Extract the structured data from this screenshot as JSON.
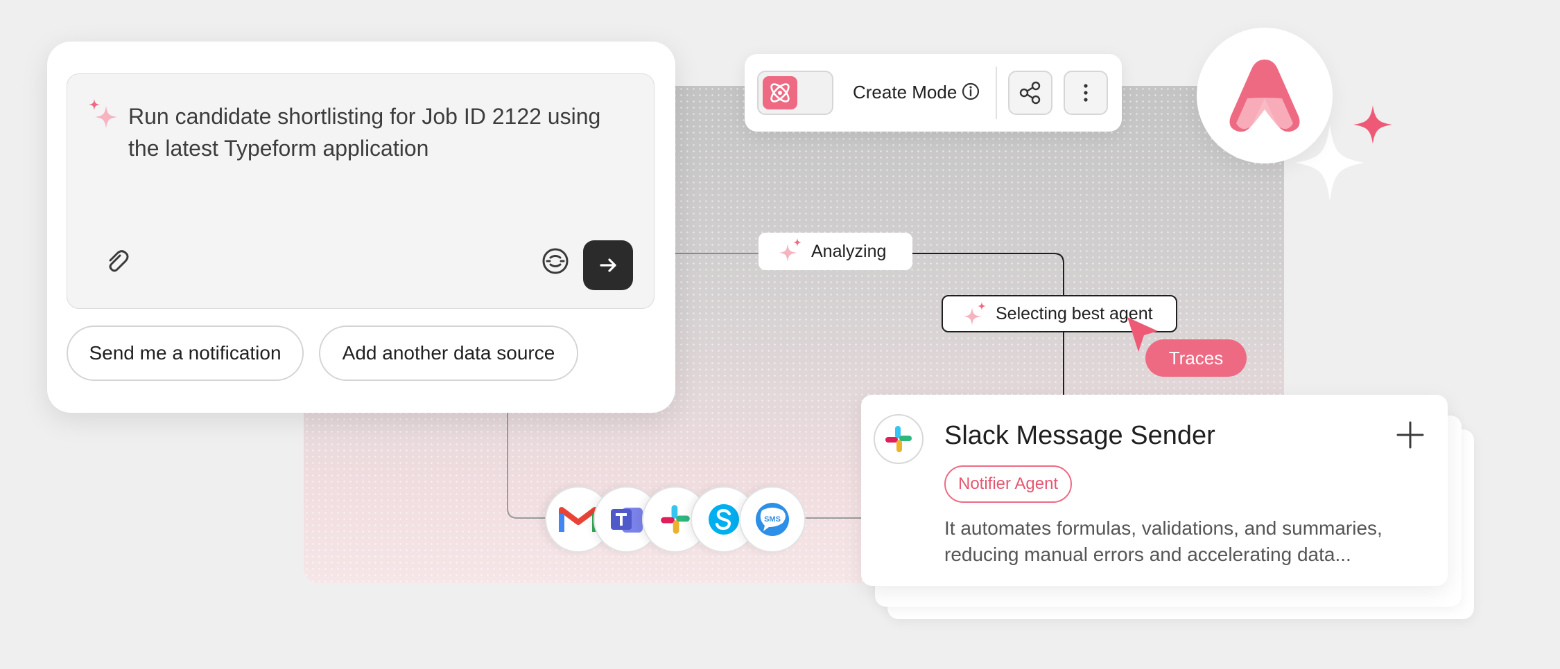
{
  "prompt": {
    "text": "Run candidate shortlisting for Job ID 2122 using the latest Typeform application",
    "suggestions": [
      "Send me a notification",
      "Add another data source"
    ]
  },
  "toolbar": {
    "mode_label": "Create Mode"
  },
  "flow": {
    "analyzing_label": "Analyzing",
    "selecting_label": "Selecting best agent",
    "traces_label": "Traces"
  },
  "agent": {
    "title": "Slack Message Sender",
    "tag": "Notifier Agent",
    "description": "It automates formulas, validations, and summaries, reducing manual errors and accelerating data..."
  },
  "channels": [
    {
      "icon": "gmail-icon"
    },
    {
      "icon": "teams-icon"
    },
    {
      "icon": "slack-icon"
    },
    {
      "icon": "skype-icon"
    },
    {
      "icon": "sms-icon",
      "label": "SMS"
    }
  ],
  "colors": {
    "accent": "#ee6a82",
    "dark_button": "#2b2b2b",
    "background": "#efefef"
  }
}
